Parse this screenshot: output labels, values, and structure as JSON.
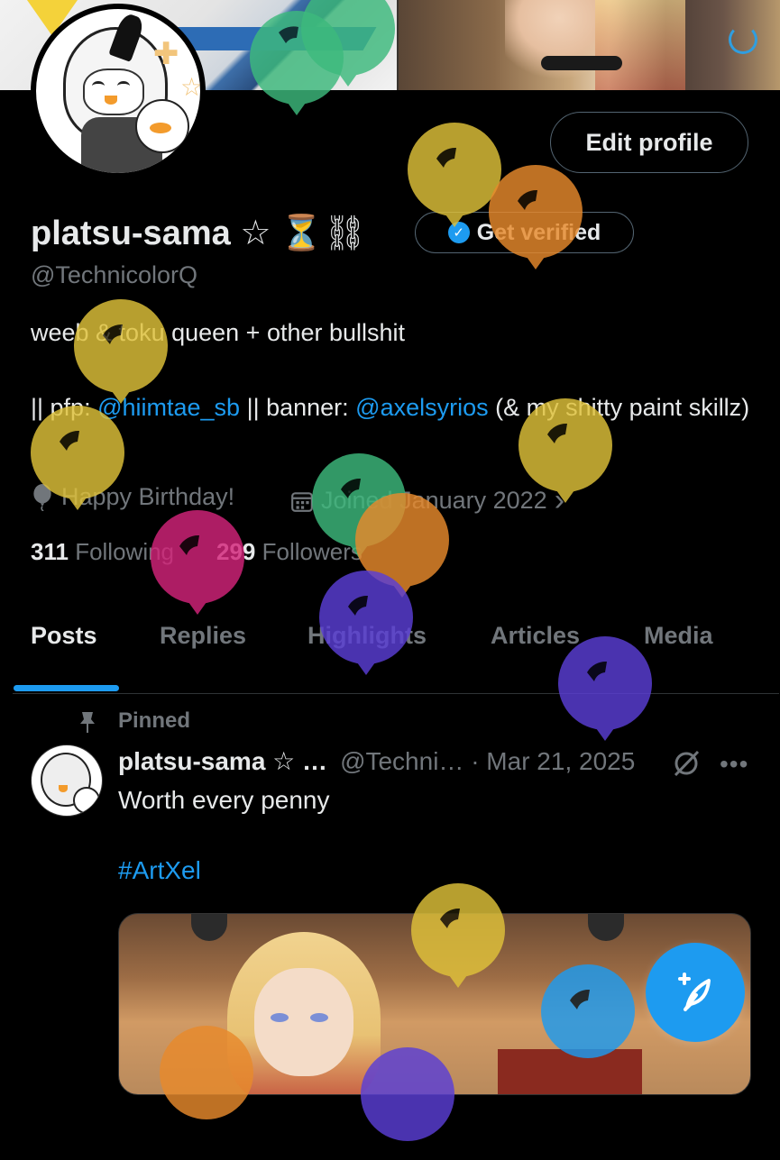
{
  "profile": {
    "edit_label": "Edit profile",
    "display_name": "platsu-sama",
    "name_emoji": "☆ ⏳⛓",
    "verify_label": "Get verified",
    "handle": "@TechnicolorQ",
    "bio_line1": "weeb & toku queen + other bullshit",
    "bio_line2_prefix": "|| pfp: ",
    "bio_pfp_link": "@hiimtae_sb",
    "bio_line2_mid": " || banner: ",
    "bio_banner_link": "@axelsyrios",
    "bio_line2_suffix": " (& my shitty paint skillz)",
    "birthday": "Happy Birthday!",
    "joined": "Joined January 2022",
    "joined_chevron": "›",
    "following_count": "311",
    "following_label": "Following",
    "followers_count": "299",
    "followers_label": "Followers"
  },
  "tabs": [
    {
      "label": "Posts",
      "active": true
    },
    {
      "label": "Replies",
      "active": false
    },
    {
      "label": "Highlights",
      "active": false
    },
    {
      "label": "Articles",
      "active": false
    },
    {
      "label": "Media",
      "active": false
    }
  ],
  "post": {
    "pinned_label": "Pinned",
    "author_name": "platsu-sama ☆ …",
    "author_meta": "@Techni… · Mar 21, 2025",
    "more": "•••",
    "text": "Worth every penny",
    "hashtag": "#ArtXel"
  },
  "colors": {
    "accent": "#1d9bf0",
    "muted": "#71767b",
    "background": "#000000"
  },
  "icons": [
    "balloon-icon",
    "calendar-icon",
    "pin-icon",
    "grok-icon",
    "more-icon",
    "compose-icon",
    "verified-badge-icon"
  ],
  "balloons": [
    {
      "color": "#3dba7d"
    },
    {
      "color": "#3dba7d"
    },
    {
      "color": "#e0c23a"
    },
    {
      "color": "#e88a2c"
    },
    {
      "color": "#e0c23a"
    },
    {
      "color": "#e0c23a"
    },
    {
      "color": "#e0c23a"
    },
    {
      "color": "#3dba7d"
    },
    {
      "color": "#e88a2c"
    },
    {
      "color": "#d4247a"
    },
    {
      "color": "#5b3fd6"
    },
    {
      "color": "#5b3fd6"
    },
    {
      "color": "#e0c23a"
    },
    {
      "color": "#1d9bf0"
    },
    {
      "color": "#e88a2c"
    },
    {
      "color": "#5b3fd6"
    }
  ]
}
